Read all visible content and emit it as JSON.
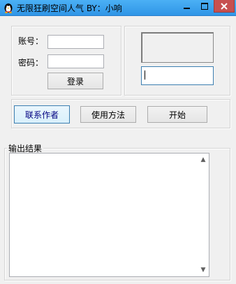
{
  "window": {
    "title": "无限狂刷空间人气 BY：小响"
  },
  "login": {
    "account_label": "账号：",
    "account_value": "",
    "password_label": "密码：",
    "password_value": "",
    "login_button": "登录"
  },
  "actions": {
    "contact_author": "联系作者",
    "usage": "使用方法",
    "start": "开始"
  },
  "output": {
    "group_title": "输出结果",
    "text": ""
  },
  "icons": {
    "app": "penguin-icon",
    "minimize": "minimize-icon",
    "maximize": "maximize-icon",
    "close": "close-icon",
    "scroll_up": "scroll-up-arrow-icon",
    "scroll_down": "scroll-down-arrow-icon"
  },
  "colors": {
    "titlebar": "#3aa2ee",
    "close_button": "#c75050",
    "window_bg": "#f0f0f0",
    "focus_border": "#3c7fb1"
  }
}
